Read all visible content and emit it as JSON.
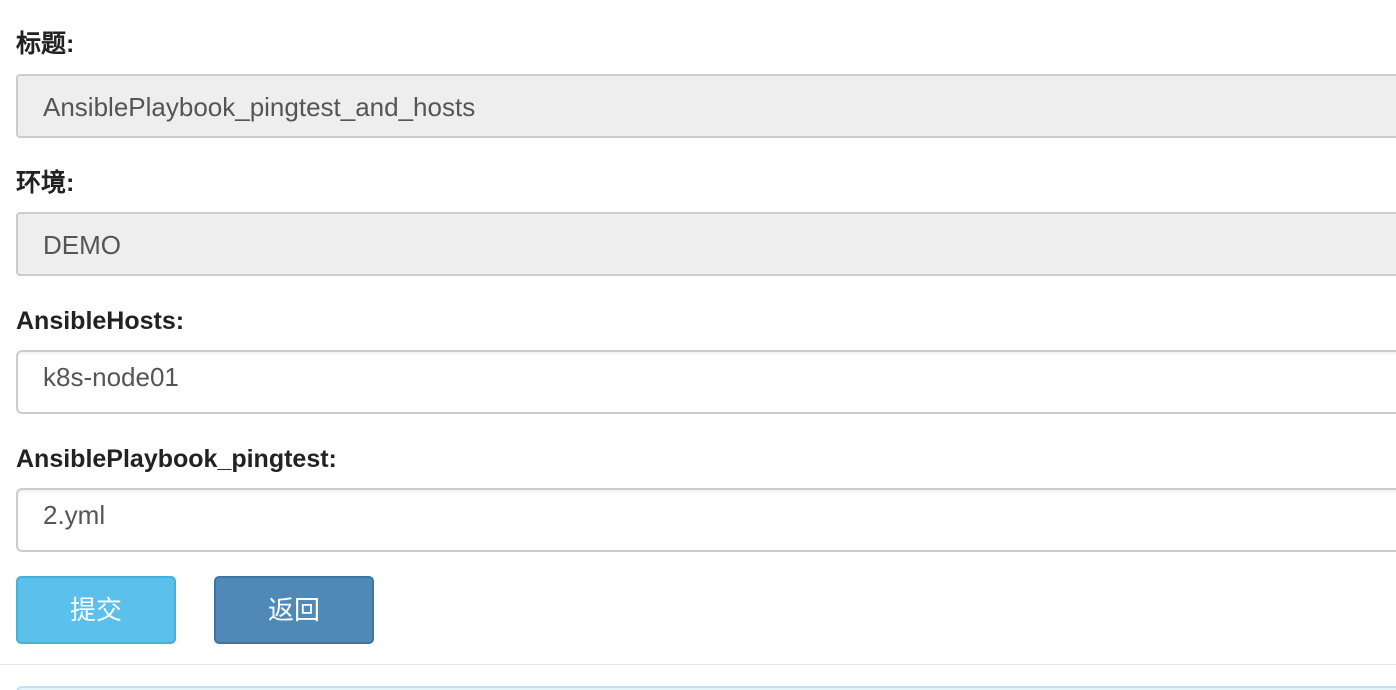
{
  "form": {
    "title": {
      "label": "标题:",
      "value": "AnsiblePlaybook_pingtest_and_hosts"
    },
    "environment": {
      "label": "环境:",
      "value": "DEMO"
    },
    "ansible_hosts": {
      "label": "AnsibleHosts:",
      "value": "k8s-node01"
    },
    "ansible_playbook": {
      "label": "AnsiblePlaybook_pingtest:",
      "value": "2.yml"
    }
  },
  "actions": {
    "submit_label": "提交",
    "back_label": "返回"
  },
  "colors": {
    "submit": "#5bc0ea",
    "back": "#4f89b8",
    "readonly_bg": "#eeeeee",
    "alert_bg": "#e4f4fb"
  }
}
